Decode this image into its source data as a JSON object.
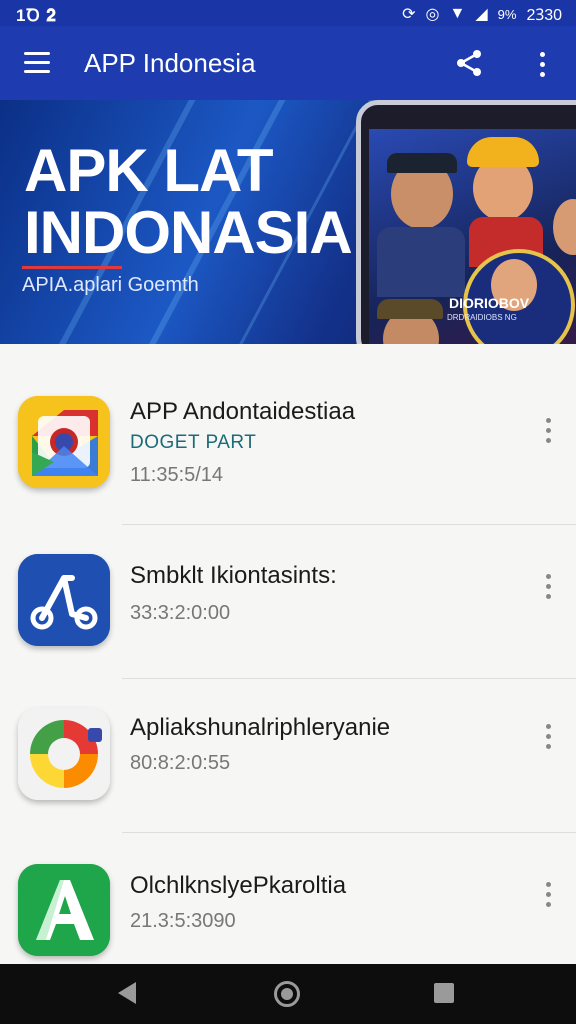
{
  "status_bar": {
    "left_text": "1Ꝺ 𝟐",
    "battery": "9%",
    "time": "2Ꝫ30"
  },
  "app_bar": {
    "title": "APP Indonesia"
  },
  "banner": {
    "title_line1": "APK LAT",
    "title_line2": "INDONASIA",
    "subtitle": "APIA.aplari Goemth",
    "phone_badge": "DIORIOBOV",
    "phone_badge_small": "DRDRAIDIOBS NG"
  },
  "apps": [
    {
      "title": "APP Andontaidestiaa",
      "subtitle": "DOGET PART",
      "time": "11:35:5/14",
      "icon": "google-maps-style-icon",
      "colors": {
        "bg": "#f6c21c"
      }
    },
    {
      "title": "Smbklt Ikiontasints:",
      "subtitle": "",
      "time": "33:3:2:0:00",
      "icon": "scooter-icon",
      "colors": {
        "bg": "#1f4fb0"
      }
    },
    {
      "title": "Apliakshunalriphleryanie",
      "subtitle": "",
      "time": "80:8:2:0:55",
      "icon": "circular-arrows-icon",
      "colors": {
        "bg": "#ffffff"
      }
    },
    {
      "title": "OlchlknslyePkaroltia",
      "subtitle": "",
      "time": "21.3:5:3090",
      "icon": "letter-a-icon",
      "colors": {
        "bg": "#1fa64a"
      }
    }
  ],
  "theme": {
    "primary": "#1e3cb0",
    "nav_bar": "#0d0d0d"
  }
}
